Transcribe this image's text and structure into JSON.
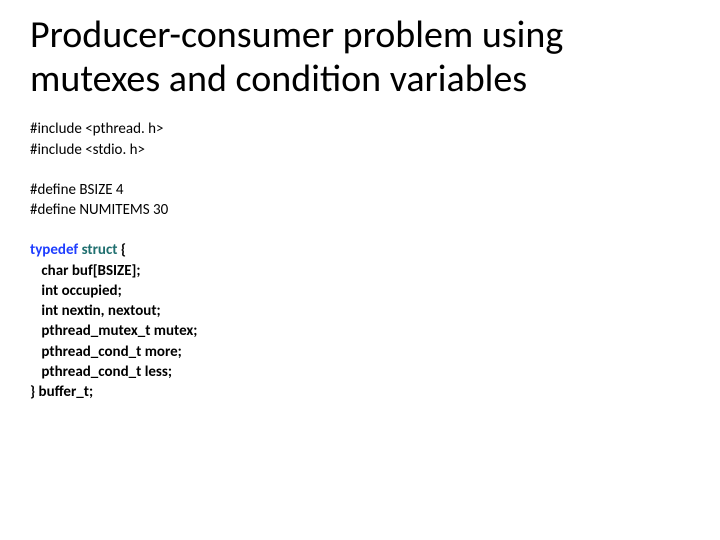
{
  "title": "Producer-consumer problem using mutexes and condition variables",
  "includes": {
    "l1": "#include <pthread. h>",
    "l2": "#include <stdio. h>"
  },
  "defines": {
    "l1": "#define BSIZE 4",
    "l2": "#define NUMITEMS 30"
  },
  "struct": {
    "kw_typedef": "typedef",
    "kw_struct": "struct",
    "brace_open": " {",
    "m1": " char buf[BSIZE];",
    "m2": " int occupied;",
    "m3": " int nextin, nextout;",
    "m4": " pthread_mutex_t mutex;",
    "m5": " pthread_cond_t more;",
    "m6": " pthread_cond_t less;",
    "close": "} buffer_t;"
  }
}
